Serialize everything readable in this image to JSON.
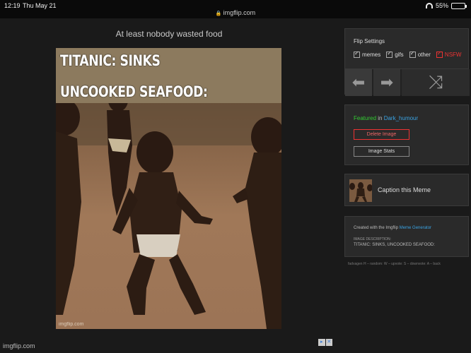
{
  "status_bar": {
    "time": "12:19",
    "date": "Thu May 21",
    "url": "imgflip.com",
    "battery": "55%"
  },
  "meme": {
    "title": "At least nobody wasted food",
    "caption_top": "TITANIC: SINKS",
    "caption_bottom": "UNCOOKED SEAFOOD:",
    "watermark": "imgflip.com"
  },
  "flip_settings": {
    "title": "Flip Settings",
    "options": [
      {
        "label": "memes",
        "checked": true
      },
      {
        "label": "gifs",
        "checked": true
      },
      {
        "label": "other",
        "checked": true
      },
      {
        "label": "NSFW",
        "checked": true,
        "color": "#e33333"
      }
    ]
  },
  "featured": {
    "prefix": "Featured",
    "in_word": " in ",
    "stream": "Dark_humour",
    "delete_label": "Delete Image",
    "stats_label": "Image Stats"
  },
  "caption_this": {
    "label": "Caption this Meme"
  },
  "info": {
    "created_prefix": "Created with the Imgflip ",
    "created_link": "Meme Generator",
    "description_label": "IMAGE DESCRIPTION:",
    "description_text": "TITANIC: SINKS, UNCOOKED SEAFOOD:"
  },
  "shortcuts": "fadvagen H – random: W – upvote: S – downvote: A – back",
  "footer": {
    "logo": "imgflip.com"
  },
  "colors": {
    "accent_link": "#3aa3e3",
    "featured_green": "#33cc33",
    "danger": "#e33333"
  }
}
